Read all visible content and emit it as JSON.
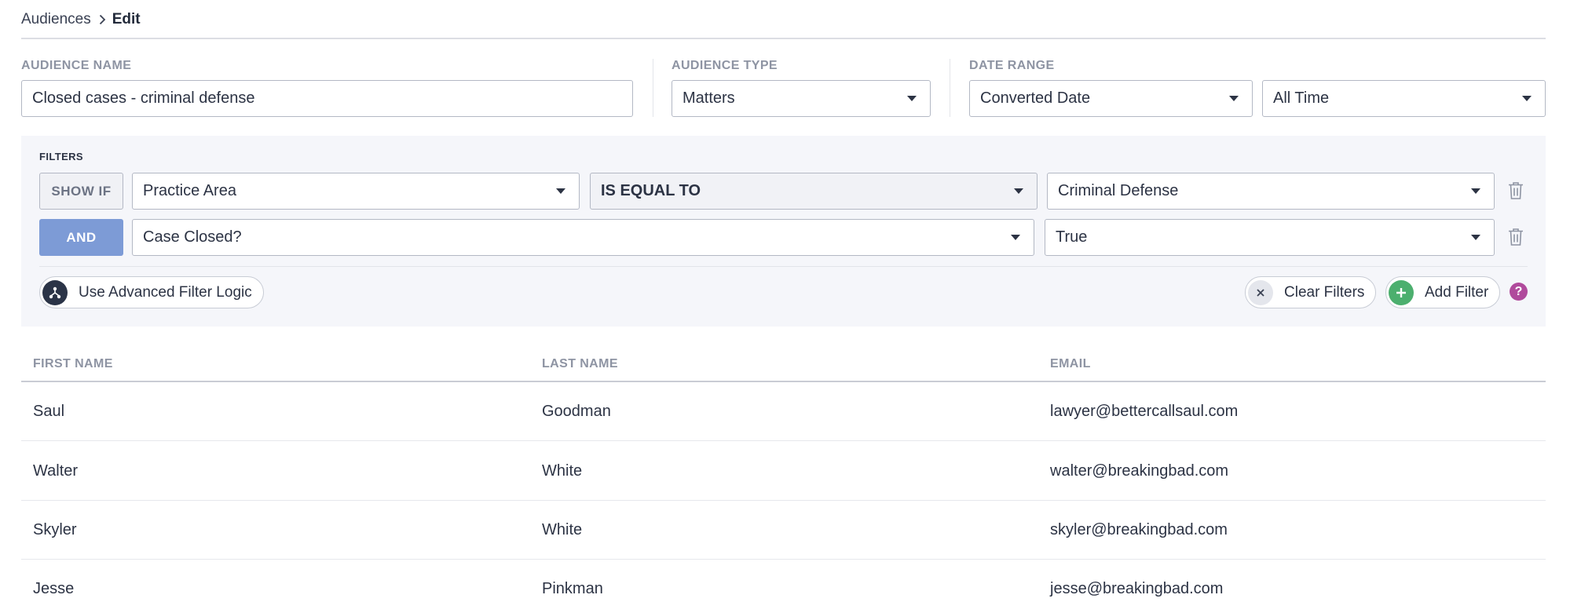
{
  "breadcrumb": {
    "parent": "Audiences",
    "current": "Edit"
  },
  "audience_name": {
    "label": "AUDIENCE NAME",
    "value": "Closed cases - criminal defense"
  },
  "audience_type": {
    "label": "AUDIENCE TYPE",
    "value": "Matters"
  },
  "date_range": {
    "label": "DATE RANGE",
    "field": "Converted Date",
    "period": "All Time"
  },
  "filters": {
    "title": "FILTERS",
    "rows": [
      {
        "condition": "SHOW IF",
        "field": "Practice Area",
        "operator": "IS EQUAL TO",
        "value": "Criminal Defense"
      },
      {
        "condition": "AND",
        "field": "Case Closed?",
        "value": "True"
      }
    ],
    "advanced_label": "Use Advanced Filter Logic",
    "clear_label": "Clear Filters",
    "add_label": "Add Filter",
    "help_glyph": "?"
  },
  "table": {
    "headers": [
      "FIRST NAME",
      "LAST NAME",
      "EMAIL"
    ],
    "rows": [
      [
        "Saul",
        "Goodman",
        "lawyer@bettercallsaul.com"
      ],
      [
        "Walter",
        "White",
        "walter@breakingbad.com"
      ],
      [
        "Skyler",
        "White",
        "skyler@breakingbad.com"
      ],
      [
        "Jesse",
        "Pinkman",
        "jesse@breakingbad.com"
      ]
    ]
  },
  "icons": {
    "breadcrumb_separator": "chevron-right-icon",
    "dropdown": "caret-down-icon",
    "delete": "trash-icon",
    "advanced": "hierarchy-icon",
    "clear": "close-icon",
    "add": "plus-icon",
    "help": "question-icon"
  },
  "colors": {
    "and_button": "#7d9bd6",
    "add_icon": "#4caf6e",
    "help_icon": "#b04a9c",
    "advanced_icon": "#2b3447"
  }
}
